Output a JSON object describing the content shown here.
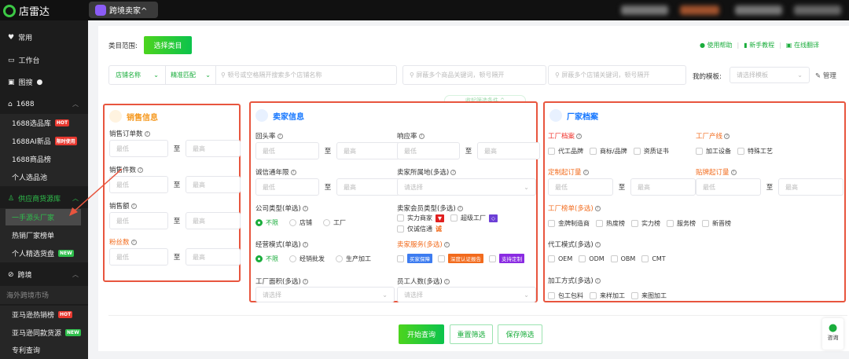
{
  "app": {
    "logo": "店雷达",
    "mode_switch": "跨境卖家^"
  },
  "sidebar": {
    "items": [
      {
        "label": "常用",
        "icon": "heart-icon"
      },
      {
        "label": "工作台",
        "icon": "monitor-icon"
      },
      {
        "label": "图搜",
        "icon": "image-icon"
      },
      {
        "label": "1688",
        "icon": "shop-icon"
      },
      {
        "label": "1688选品库",
        "badge": "HOT"
      },
      {
        "label": "1688AI新品",
        "badge": "限时使用"
      },
      {
        "label": "1688商品榜"
      },
      {
        "label": "个人选品池"
      },
      {
        "label": "供应商货源库",
        "icon": "user-icon"
      },
      {
        "label": "一手源头厂家"
      },
      {
        "label": "热销厂家榜单"
      },
      {
        "label": "个人精选货盘",
        "badge": "NEW"
      },
      {
        "label": "跨境",
        "icon": "planet-icon"
      },
      {
        "label": "海外跨境市场"
      },
      {
        "label": "亚马逊热销榜",
        "badge": "HOT"
      },
      {
        "label": "亚马逊同款货源",
        "badge": "NEW"
      },
      {
        "label": "专利查询"
      }
    ]
  },
  "header": {
    "category_label": "类目范围:",
    "category_button": "选择类目",
    "help": "使用帮助",
    "tutorial": "新手教程",
    "translate": "在线翻译"
  },
  "search": {
    "field_select": "店铺名称",
    "match_select": "精准匹配",
    "store_placeholder": "顿号或空格隔开搜索多个店铺名称",
    "block_product_placeholder": "屏蔽多个商品关键词，顿号隔开",
    "block_store_placeholder": "屏蔽多个店铺关键词，顿号隔开",
    "template_label": "我的模板:",
    "template_placeholder": "请选择模板",
    "manage": "管理",
    "collapse": "收起筛选条件 ^"
  },
  "common": {
    "min": "最低",
    "max": "最高",
    "to": "至",
    "select": "请选择"
  },
  "sales": {
    "title": "销售信息",
    "fields": [
      "销售订单数",
      "销售件数",
      "销售额",
      "粉丝数"
    ]
  },
  "seller": {
    "title": "卖家信息",
    "repeat_rate": "回头率",
    "response_rate": "响应率",
    "cxt_years": "诚信通年限",
    "location": "卖家所属地(多选)",
    "company_type": {
      "label": "公司类型(单选)",
      "options": [
        "不限",
        "店铺",
        "工厂"
      ]
    },
    "member_type": {
      "label": "卖家会员类型(多选)",
      "options": [
        "实力商家",
        "超级工厂",
        "仅诚信通"
      ]
    },
    "business_mode": {
      "label": "经营模式(单选)",
      "options": [
        "不限",
        "经销批发",
        "生产加工"
      ]
    },
    "services": {
      "label": "卖家服务(多选)",
      "options": [
        "买家保障",
        "深度认证报告",
        "支持定制"
      ]
    },
    "factory_area": "工厂面积(多选)",
    "staff_count": "员工人数(多选)"
  },
  "factory": {
    "title": "厂家档案",
    "archive": {
      "label": "工厂档案",
      "options": [
        "代工品牌",
        "商标/品牌",
        "资质证书"
      ]
    },
    "line": {
      "label": "工厂产线",
      "options": [
        "加工设备",
        "特殊工艺"
      ]
    },
    "custom_moq": "定制起订量",
    "label_moq": "贴牌起订量",
    "ranking": {
      "label": "工厂榜单(多选)",
      "options": [
        "金牌制造商",
        "热度榜",
        "实力榜",
        "服务榜",
        "新晋榜"
      ]
    },
    "oem_mode": {
      "label": "代工模式(多选)",
      "options": [
        "OEM",
        "ODM",
        "OBM",
        "CMT"
      ]
    },
    "process": {
      "label": "加工方式(多选)",
      "options": [
        "包工包料",
        "来样加工",
        "来图加工"
      ]
    }
  },
  "actions": {
    "search": "开始查询",
    "reset": "重置筛选",
    "save": "保存筛选",
    "consult": "咨询"
  },
  "colors": {
    "green": "#1aad3c",
    "orange": "#f26b1d",
    "highlight_border": "#e8553e",
    "blue": "#1677ff"
  }
}
